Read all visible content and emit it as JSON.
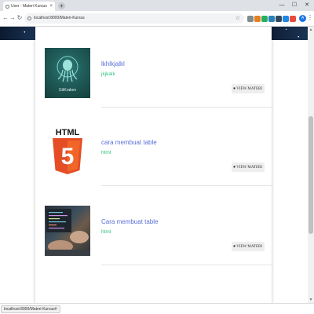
{
  "browser": {
    "tab_title": "User - Materi Kursus",
    "tab_close": "×",
    "new_tab": "+",
    "minimize": "—",
    "maximize": "☐",
    "close": "✕",
    "back": "←",
    "forward": "→",
    "reload": "↻",
    "url": "localhost:8000/Materi-Kursus",
    "bookmark_star": "☆",
    "profile_initial": "A",
    "menu": "⋮",
    "extension_colors": [
      "#7f8c8d",
      "#e67e22",
      "#27ae60",
      "#2980b9",
      "#34495e",
      "#1e88e5",
      "#e74c3c"
    ]
  },
  "courses": [
    {
      "title": "lkhlkjalkl",
      "category": "jkjkalk",
      "image_label": "GitKraken",
      "button": "VIEW MATERI",
      "button_icon": "●"
    },
    {
      "title": "cara membuat table",
      "category": "html",
      "image_label": "HTML",
      "badge_number": "5",
      "button": "VIEW MATERI",
      "button_icon": "●"
    },
    {
      "title": "Cara membuat table",
      "category": "html",
      "button": "VIEW MATERI",
      "button_icon": "●"
    }
  ],
  "status_bar": {
    "link": "localhost:8000/Materi-Kursus#"
  },
  "colors": {
    "title": "#5a6fd6",
    "category": "#2ec27e",
    "html5_orange": "#e44d26",
    "html5_light": "#f16529"
  }
}
